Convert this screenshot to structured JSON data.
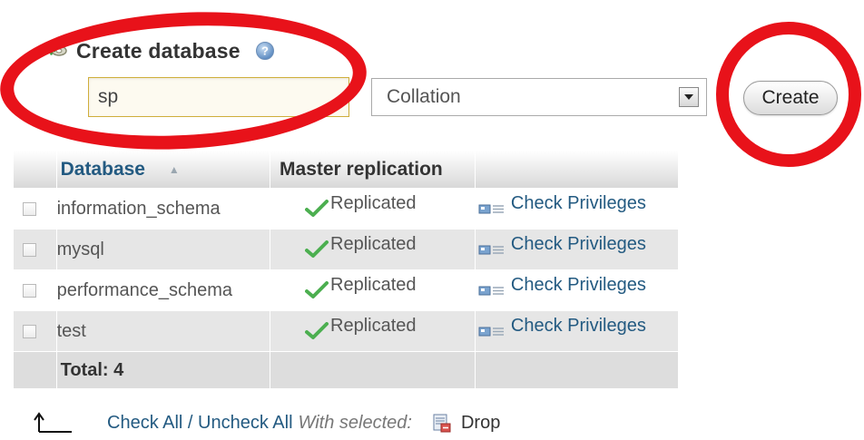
{
  "create_database": {
    "title": "Create database",
    "name_value": "sp",
    "collation_label": "Collation",
    "create_button": "Create"
  },
  "table": {
    "headers": {
      "database": "Database",
      "master_replication": "Master replication"
    },
    "rows": [
      {
        "name": "information_schema",
        "replication": "Replicated",
        "action": "Check Privileges"
      },
      {
        "name": "mysql",
        "replication": "Replicated",
        "action": "Check Privileges"
      },
      {
        "name": "performance_schema",
        "replication": "Replicated",
        "action": "Check Privileges"
      },
      {
        "name": "test",
        "replication": "Replicated",
        "action": "Check Privileges"
      }
    ],
    "total": "Total: 4"
  },
  "footer": {
    "check_all": "Check All / Uncheck All",
    "with_selected": "With selected:",
    "drop": "Drop"
  },
  "colors": {
    "annotation": "#e8121a",
    "link": "#235a81",
    "replicated_check": "#4caf50"
  },
  "icons": {
    "create_db": "database-add-icon",
    "help": "help-icon",
    "replicated": "check-icon",
    "privileges": "privileges-icon",
    "select_all_arrow": "arrow-up-icon",
    "drop": "drop-icon"
  }
}
